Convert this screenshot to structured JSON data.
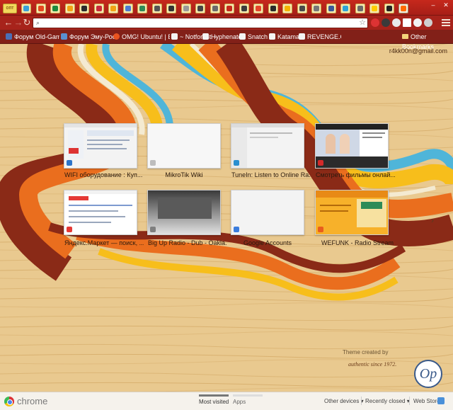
{
  "colors": {
    "tabstrip": "#b9241a",
    "bookmarks_bar": "#822018",
    "wood": "#e9c98f",
    "swirl_red": "#8a2a17",
    "swirl_orange": "#ea6e1e",
    "swirl_yellow": "#f7be1b",
    "swirl_blue": "#4fb5d9",
    "swirl_cream": "#f4ead1"
  },
  "tabs": {
    "first_label": "опт",
    "favicon_colors": [
      "#3aa0d8",
      "#e5471f",
      "#1c8a3c",
      "#f2a214",
      "#2b2b2b",
      "#c92a3a",
      "#f2a214",
      "#4d7bd1",
      "#2e8b57",
      "#555555",
      "#333333",
      "#999999",
      "#444444",
      "#6a6a6a",
      "#c6281c",
      "#3c3c3c",
      "#e6452a",
      "#2a2a2a",
      "#f4b400",
      "#4a4a4a",
      "#777777",
      "#3b5998",
      "#2ea3d6",
      "#6a6a6a",
      "#ffcc00",
      "#222222",
      "#ff6a00"
    ]
  },
  "toolbar": {
    "back_icon": "back-arrow-icon",
    "forward_icon": "forward-arrow-icon",
    "reload_icon": "reload-icon",
    "omnibox_value": "",
    "omnibox_placeholder": ""
  },
  "bookmarks": {
    "items": [
      {
        "label": "Форум Old-Game...",
        "color": "#4b6fb5"
      },
      {
        "label": "Форум Эму-Росси...",
        "color": "#5a8fd0"
      },
      {
        "label": "OMG! Ubuntu! | Ev...",
        "color": "#e95420"
      },
      {
        "label": "~ Notforest ~",
        "color": "#f3f3f3"
      },
      {
        "label": "Hyphenate!",
        "color": "#f3f3f3"
      },
      {
        "label": "Snatch It",
        "color": "#f3f3f3"
      },
      {
        "label": "Katamari!",
        "color": "#f3f3f3"
      },
      {
        "label": "REVENGE.CSS",
        "color": "#f3f3f3"
      }
    ],
    "other": "Other Bookmarks"
  },
  "account": "r4kk00n@gmail.com",
  "most_visited": [
    {
      "title": "WIFI оборудование : Куп...",
      "favicon": "#2c74c9"
    },
    {
      "title": "MikroTik Wiki",
      "favicon": "#bdbdbd"
    },
    {
      "title": "TuneIn: Listen to Online Ra...",
      "favicon": "#2a8fd0"
    },
    {
      "title": "Смотреть фильмы онлай...",
      "favicon": "#d42a2a"
    },
    {
      "title": "Яндекс.Маркет — поиск, ...",
      "favicon": "#e53935"
    },
    {
      "title": "Big Up Radio - Dub - Oakla...",
      "favicon": "#7f7f7f"
    },
    {
      "title": "Google Accounts",
      "favicon": "#3b7ddd"
    },
    {
      "title": "WEFUNK - Radio Stream",
      "favicon": "#e85d1d"
    }
  ],
  "theme": {
    "created_by": "Theme created by",
    "tagline": "authentic since 1972.",
    "logo_text": "Op"
  },
  "footer": {
    "brand": "chrome",
    "tabs": [
      {
        "label": "Most visited",
        "active": true
      },
      {
        "label": "Apps",
        "active": false
      }
    ],
    "other_devices": "Other devices ▾",
    "recently_closed": "Recently closed ▾",
    "web_store": "Web Store"
  }
}
